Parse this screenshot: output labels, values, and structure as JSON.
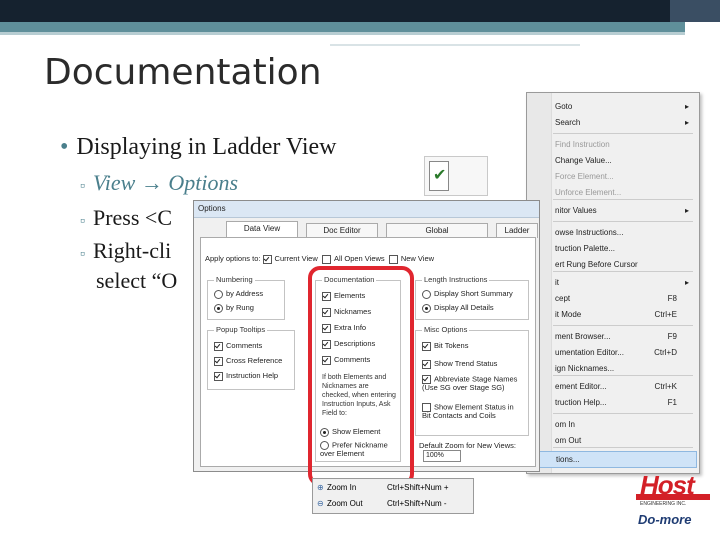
{
  "slide": {
    "title": "Documentation",
    "bullet": "Displaying in Ladder View",
    "sub1_a": "View",
    "sub1_arrow": "→",
    "sub1_b": "Options",
    "sub2": "Press <C",
    "sub3": "Right-cli",
    "sub3_cont": "select “O"
  },
  "context_menu": {
    "items": [
      {
        "label": "Goto",
        "shortcut": "",
        "arrow": "▸"
      },
      {
        "label": "Search",
        "shortcut": "",
        "arrow": "▸"
      },
      {
        "label": "Find Instruction",
        "shortcut": "",
        "arrow": ""
      },
      {
        "label": "Change Value...",
        "shortcut": "",
        "arrow": ""
      },
      {
        "label": "Force Element...",
        "shortcut": "",
        "arrow": ""
      },
      {
        "label": "Unforce Element...",
        "shortcut": "",
        "arrow": ""
      },
      {
        "label": "nitor Values",
        "shortcut": "",
        "arrow": "▸"
      },
      {
        "label": "owse Instructions...",
        "shortcut": "",
        "arrow": ""
      },
      {
        "label": "truction Palette...",
        "shortcut": "",
        "arrow": ""
      },
      {
        "label": "ert Rung Before Cursor",
        "shortcut": "",
        "arrow": ""
      },
      {
        "label": "it",
        "shortcut": "",
        "arrow": "▸"
      },
      {
        "label": "cept",
        "shortcut": "F8",
        "arrow": ""
      },
      {
        "label": "it Mode",
        "shortcut": "Ctrl+E",
        "arrow": ""
      },
      {
        "label": "ment Browser...",
        "shortcut": "F9",
        "arrow": ""
      },
      {
        "label": "umentation Editor...",
        "shortcut": "Ctrl+D",
        "arrow": ""
      },
      {
        "label": "ign Nicknames...",
        "shortcut": "",
        "arrow": ""
      },
      {
        "label": "ement Editor...",
        "shortcut": "Ctrl+K",
        "arrow": ""
      },
      {
        "label": "truction Help...",
        "shortcut": "F1",
        "arrow": ""
      },
      {
        "label": "om In",
        "shortcut": "",
        "arrow": ""
      },
      {
        "label": "om Out",
        "shortcut": "",
        "arrow": ""
      },
      {
        "label": "tions...",
        "shortcut": "",
        "arrow": ""
      }
    ]
  },
  "options_dialog": {
    "caption": "Options",
    "tabs": [
      "Data View",
      "Doc Editor",
      "Global",
      "Ladder"
    ],
    "apply_label": "Apply options to:",
    "apply_current": "Current View",
    "apply_all": "All Open Views",
    "apply_new": "New View",
    "numbering": {
      "label": "Numbering",
      "opt1": "by Address",
      "opt2": "by Rung"
    },
    "popup": {
      "label": "Popup Tooltips",
      "opt1": "Comments",
      "opt2": "Cross Reference",
      "opt3": "Instruction Help"
    },
    "documentation": {
      "label": "Documentation",
      "opt1": "Elements",
      "opt2": "Nicknames",
      "opt3": "Extra Info",
      "opt4": "Descriptions",
      "opt5": "Comments",
      "note": "If both Elements and Nicknames are checked, when entering Instruction Inputs, Ask Field to:",
      "radio1": "Show Element",
      "radio2": "Prefer Nickname over Element"
    },
    "length": {
      "label": "Length Instructions",
      "opt1": "Display Short Summary",
      "opt2": "Display All Details"
    },
    "misc": {
      "label": "Misc Options",
      "opt1": "Bit Tokens",
      "opt2": "Show Trend Status",
      "opt3": "Abbreviate Stage Names (Use SG over Stage SG)",
      "opt4": "Show Element Status in Bit Contacts and Coils"
    },
    "zoom_label": "Default Zoom for New Views:",
    "zoom_value": "100%"
  },
  "zoom_menu": {
    "zoom_in": "Zoom In",
    "zoom_in_sc": "Ctrl+Shift+Num +",
    "zoom_out": "Zoom Out",
    "zoom_out_sc": "Ctrl+Shift+Num -"
  },
  "logo": {
    "host": "Host",
    "sub": "ENGINEERING INC.",
    "brand": "Do-more"
  },
  "colors": {
    "highlight": "#e0262f",
    "accent": "#4a7f8c",
    "topbar": "#15222f"
  }
}
